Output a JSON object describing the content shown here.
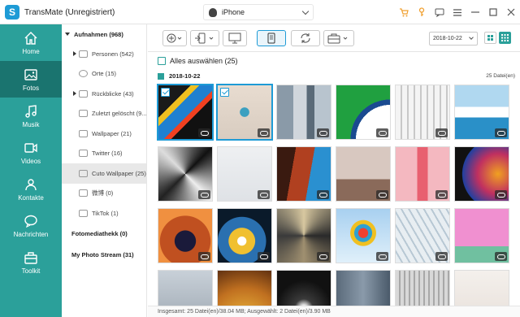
{
  "app": {
    "title": "TransMate (Unregistriert)",
    "logo_letter": "S"
  },
  "device": {
    "name": "iPhone"
  },
  "nav": [
    {
      "label": "Home",
      "icon": "home-icon"
    },
    {
      "label": "Fotos",
      "icon": "photo-icon"
    },
    {
      "label": "Musik",
      "icon": "music-icon"
    },
    {
      "label": "Videos",
      "icon": "video-icon"
    },
    {
      "label": "Kontakte",
      "icon": "contacts-icon"
    },
    {
      "label": "Nachrichten",
      "icon": "message-icon"
    },
    {
      "label": "Toolkit",
      "icon": "toolkit-icon"
    }
  ],
  "albums": {
    "header": "Aufnahmen (968)",
    "items": [
      "Personen (542)",
      "Orte (15)",
      "Rückblicke (43)",
      "Zuletzt gelöscht (9...",
      "Wallpaper (21)",
      "Twitter (16)",
      "Cuto Wallpaper (25)",
      "微博 (0)",
      "TikTok (1)"
    ],
    "sections": [
      "Fotomediathekk (0)",
      "My Photo Stream (31)"
    ]
  },
  "toolbar": {
    "date": "2018-10-22"
  },
  "main": {
    "select_all": "Alles auswählen (25)",
    "date_group": "2018-10-22",
    "group_count": "25 Datei(en)"
  },
  "status": "Insgesamt: 25 Datei(en)/38.04 MB; Ausgewählt: 2 Datei(en)/3.90 MB",
  "colors": {
    "accent": "#2ba09a",
    "accent_dark": "#1a746f",
    "blue": "#1e9bd6",
    "orange": "#f0a030"
  }
}
